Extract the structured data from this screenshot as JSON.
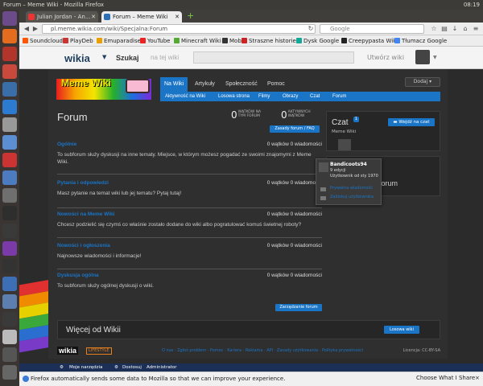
{
  "os": {
    "window_title": "Forum – Meme Wiki - Mozilla Firefox",
    "time": "08:19"
  },
  "tabs": [
    {
      "label": "Julian Jordan - An..."
    },
    {
      "label": "Forum – Meme Wiki"
    }
  ],
  "url": {
    "value": "pl.meme.wikia.com/wiki/Specjalna:Forum",
    "search_placeholder": "Google"
  },
  "bookmarks": [
    "Soundcloud",
    "PlayDeb",
    "Emuparadise",
    "YouTube",
    "Minecraft Wiki",
    "Mob",
    "Straszne historie",
    "Dysk Google",
    "Creepypasta Wiki",
    "Tłumacz Google"
  ],
  "wikia": {
    "logo": "wikia",
    "search_label": "Szukaj",
    "search_placeholder": "na tej wiki",
    "create_wiki": "Utwórz wiki"
  },
  "wiki": {
    "logo_text": "Meme Wiki",
    "nav": [
      "Na Wiki",
      "Artykuły",
      "Społeczność",
      "Pomoc"
    ],
    "subnav": [
      "Aktywność na Wiki",
      "Losowa strona",
      "Filmy",
      "Obrazy",
      "Czat",
      "Forum"
    ],
    "add_button": "Dodaj"
  },
  "forum": {
    "title": "Forum",
    "threads_count": "0",
    "threads_label": "WĄTKÓW NA TYM FORUM",
    "active_count": "0",
    "active_label": "AKTYWNYCH WĄTKÓW",
    "faq_button": "Zasady forum / FAQ",
    "boards": [
      {
        "title": "Ogólnie",
        "count": "0 wątków 0 wiadomości",
        "desc": "To subforum służy dyskusji na inne tematy. Miejsce, w którym możesz pogadać ze swoimi znajomymi z Meme Wiki."
      },
      {
        "title": "Pytania i odpowiedzi",
        "count": "0 wątków 0 wiadomości",
        "desc": "Masz pytanie na temat wiki lub jej tematu? Pytaj tutaj!"
      },
      {
        "title": "Nowości na Meme Wiki",
        "count": "0 wątków 0 wiadomości",
        "desc": "Chcesz podzielić się czymś co właśnie zostało dodane do wiki albo pogratulować komuś świetnej roboty?"
      },
      {
        "title": "Nowości i ogłoszenia",
        "count": "0 wątków 0 wiadomości",
        "desc": "Najnowsze wiadomości i informacje!"
      },
      {
        "title": "Dyskusja ogólna",
        "count": "0 wątków 0 wiadomości",
        "desc": "To subforum służy ogólnej dyskusji o wiki."
      }
    ],
    "manage_button": "Zarządzanie forum"
  },
  "chat": {
    "title": "Czat",
    "badge": "1",
    "subtitle": "Meme Wiki",
    "enter_button": "Wejdź na czat"
  },
  "rail_forum_title": "Forum",
  "popup": {
    "name": "Bandicoots94",
    "edits": "9 edycji",
    "since": "Użytkownik od sty 1970",
    "actions": [
      "Prywatna wiadomość",
      "Zablokuj użytkownika"
    ]
  },
  "more": {
    "title": "Więcej od Wikii",
    "random_button": "Losowa wiki"
  },
  "footer": {
    "logo": "wikia",
    "lifestyle": "LIFESTYLE",
    "links": "O nas · Zgłoś problem · Pomoc · Kariera · Reklama · API · Zasady użytkowania · Polityka prywatności",
    "license": "Licencja: CC-BY-SA"
  },
  "devbar": {
    "tools": "Moje narzędzia",
    "customize": "Dostosuj",
    "admin": "Administrator"
  },
  "notification": {
    "text": "Firefox automatically sends some data to Mozilla so that we can improve your experience.",
    "button": "Choose What I Share",
    "close": "×"
  }
}
